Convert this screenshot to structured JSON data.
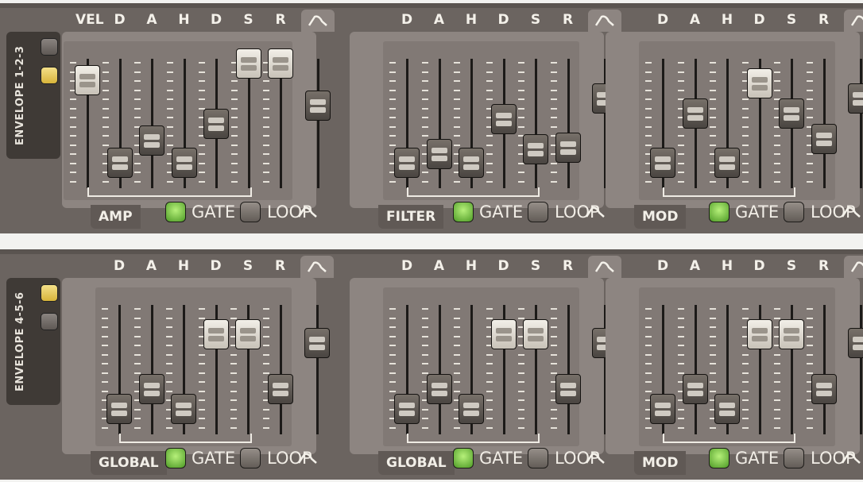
{
  "colors": {
    "panel": "#6b6460",
    "section": "#8d8581",
    "led_on": "#7ec94a",
    "select_on": "#e8c85a"
  },
  "banks": [
    {
      "title": "ENVELOPE 1-2-3",
      "select_buttons": [
        "off",
        "on"
      ],
      "sections": [
        {
          "name": "AMP",
          "faders": [
            {
              "label": "VEL",
              "value": 0.85
            },
            {
              "label": "D",
              "value": 0.1
            },
            {
              "label": "A",
              "value": 0.3
            },
            {
              "label": "H",
              "value": 0.1
            },
            {
              "label": "D",
              "value": 0.45
            },
            {
              "label": "S",
              "value": 1.0
            },
            {
              "label": "R",
              "value": 1.0
            }
          ],
          "curve_value": 0.62,
          "gate_label": "GATE",
          "gate_on": true,
          "loop_label": "LOOP",
          "loop_on": false
        },
        {
          "name": "FILTER",
          "faders": [
            {
              "label": "D",
              "value": 0.1
            },
            {
              "label": "A",
              "value": 0.18
            },
            {
              "label": "H",
              "value": 0.1
            },
            {
              "label": "D",
              "value": 0.5
            },
            {
              "label": "S",
              "value": 0.22
            },
            {
              "label": "R",
              "value": 0.24
            }
          ],
          "curve_value": 0.68,
          "gate_label": "GATE",
          "gate_on": true,
          "loop_label": "LOOP",
          "loop_on": false
        },
        {
          "name": "MOD",
          "faders": [
            {
              "label": "D",
              "value": 0.1
            },
            {
              "label": "A",
              "value": 0.55
            },
            {
              "label": "H",
              "value": 0.1
            },
            {
              "label": "D",
              "value": 0.82
            },
            {
              "label": "S",
              "value": 0.55
            },
            {
              "label": "R",
              "value": 0.32
            }
          ],
          "curve_value": 0.68,
          "gate_label": "GATE",
          "gate_on": true,
          "loop_label": "LOOP",
          "loop_on": false
        }
      ]
    },
    {
      "title": "ENVELOPE 4-5-6",
      "select_buttons": [
        "on",
        "off"
      ],
      "sections": [
        {
          "name": "GLOBAL",
          "faders": [
            {
              "label": "D",
              "value": 0.1
            },
            {
              "label": "A",
              "value": 0.28
            },
            {
              "label": "H",
              "value": 0.1
            },
            {
              "label": "D",
              "value": 0.78
            },
            {
              "label": "S",
              "value": 0.78
            },
            {
              "label": "R",
              "value": 0.28
            }
          ],
          "curve_value": 0.7,
          "gate_label": "GATE",
          "gate_on": true,
          "loop_label": "LOOP",
          "loop_on": false
        },
        {
          "name": "GLOBAL",
          "faders": [
            {
              "label": "D",
              "value": 0.1
            },
            {
              "label": "A",
              "value": 0.28
            },
            {
              "label": "H",
              "value": 0.1
            },
            {
              "label": "D",
              "value": 0.78
            },
            {
              "label": "S",
              "value": 0.78
            },
            {
              "label": "R",
              "value": 0.28
            }
          ],
          "curve_value": 0.7,
          "gate_label": "GATE",
          "gate_on": true,
          "loop_label": "LOOP",
          "loop_on": false
        },
        {
          "name": "MOD",
          "faders": [
            {
              "label": "D",
              "value": 0.1
            },
            {
              "label": "A",
              "value": 0.28
            },
            {
              "label": "H",
              "value": 0.1
            },
            {
              "label": "D",
              "value": 0.78
            },
            {
              "label": "S",
              "value": 0.78
            },
            {
              "label": "R",
              "value": 0.28
            }
          ],
          "curve_value": 0.7,
          "gate_label": "GATE",
          "gate_on": true,
          "loop_label": "LOOP",
          "loop_on": false
        }
      ]
    }
  ]
}
